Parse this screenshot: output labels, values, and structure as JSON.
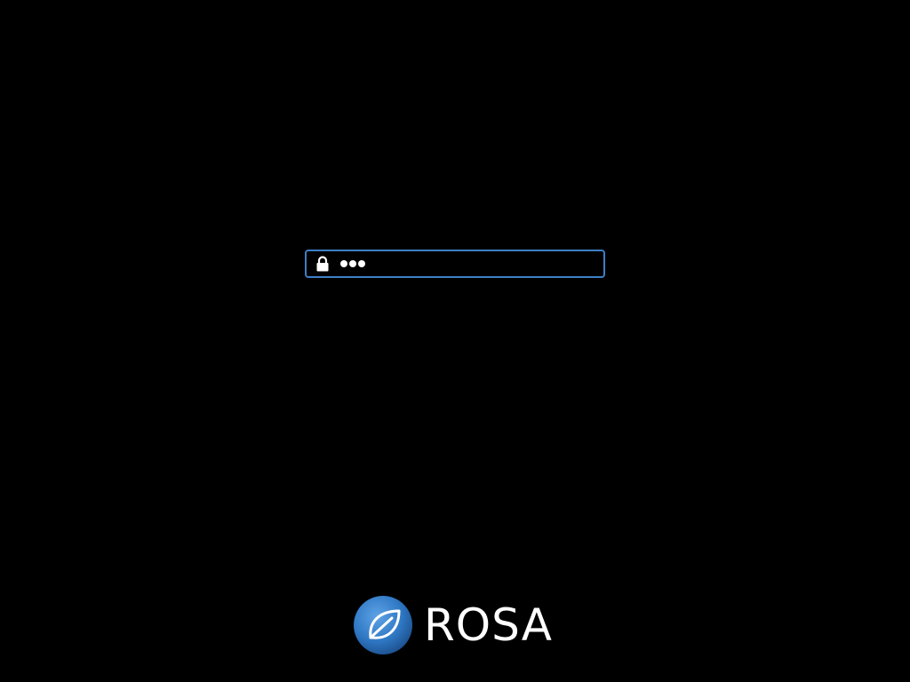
{
  "lock_screen": {
    "password_field": {
      "icon": "lock-icon",
      "masked_length": 3,
      "border_color": "#3d7fc4"
    }
  },
  "branding": {
    "logo_text": "ROSA",
    "logo_icon": "rosa-leaf-logo-icon",
    "logo_color": "#3b7fc2"
  },
  "colors": {
    "background": "#000000",
    "accent": "#3d7fc4",
    "text": "#ffffff"
  }
}
